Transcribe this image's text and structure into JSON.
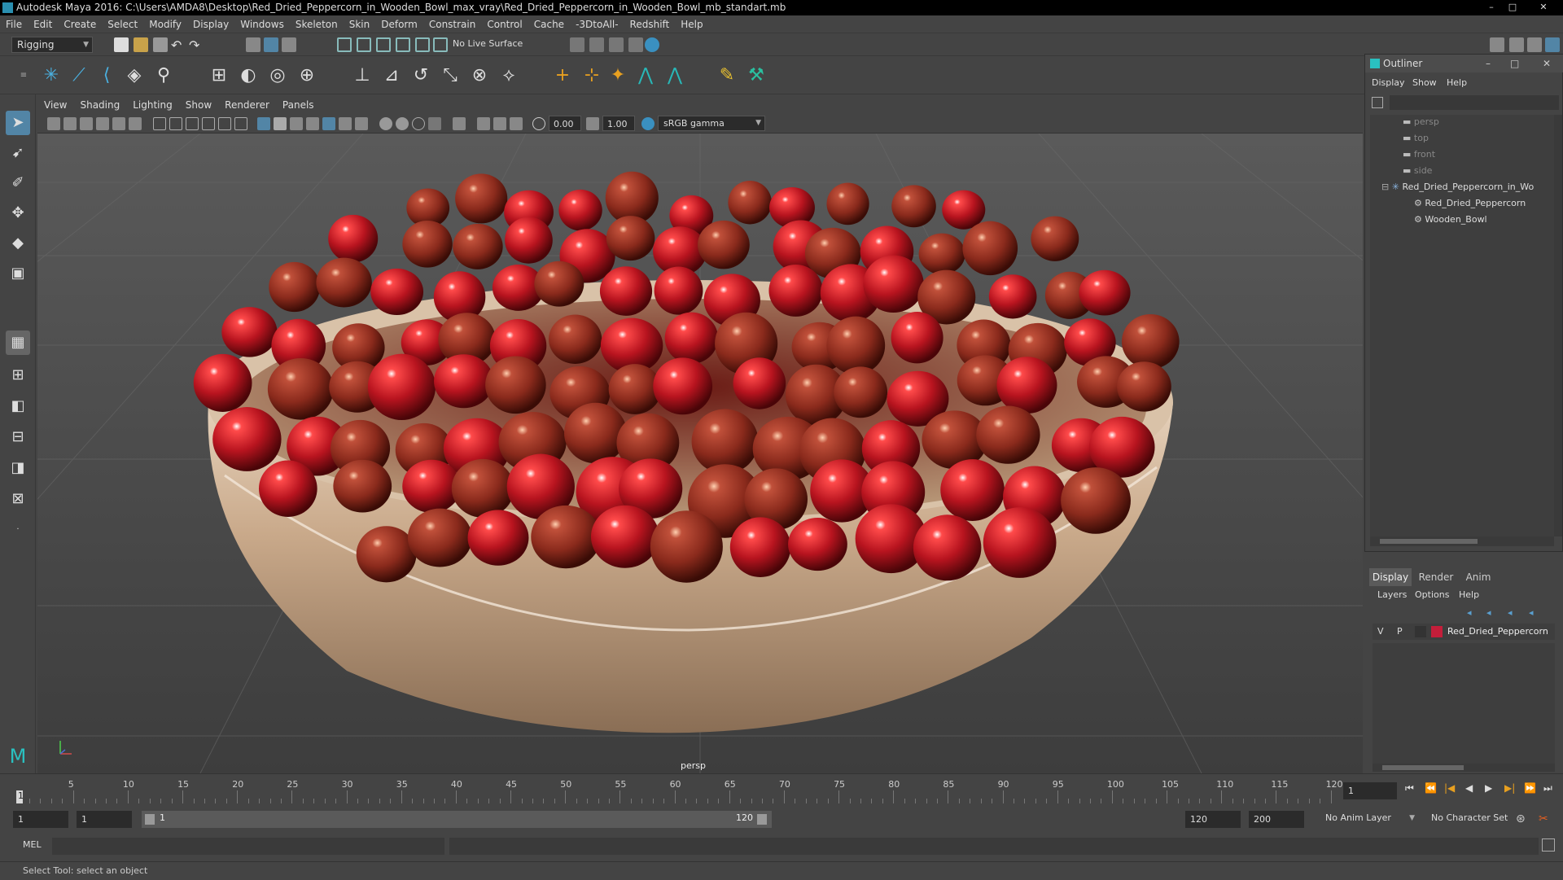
{
  "window": {
    "title": "Autodesk Maya 2016: C:\\Users\\AMDA8\\Desktop\\Red_Dried_Peppercorn_in_Wooden_Bowl_max_vray\\Red_Dried_Peppercorn_in_Wooden_Bowl_mb_standart.mb",
    "controls": [
      "–",
      "□",
      "✕"
    ]
  },
  "menubar": [
    "File",
    "Edit",
    "Create",
    "Select",
    "Modify",
    "Display",
    "Windows",
    "Skeleton",
    "Skin",
    "Deform",
    "Constrain",
    "Control",
    "Cache",
    "-3DtoAll-",
    "Redshift",
    "Help"
  ],
  "statusline": {
    "mode": "Rigging",
    "live_surface": "No Live Surface"
  },
  "viewport": {
    "menu": [
      "View",
      "Shading",
      "Lighting",
      "Show",
      "Renderer",
      "Panels"
    ],
    "exposure": "0.00",
    "gamma": "1.00",
    "color_space": "sRGB gamma",
    "camera_label": "persp"
  },
  "outliner": {
    "title": "Outliner",
    "menu": [
      "Display",
      "Show",
      "Help"
    ],
    "items": [
      {
        "label": "persp",
        "indent": 1,
        "dim": true
      },
      {
        "label": "top",
        "indent": 1,
        "dim": true
      },
      {
        "label": "front",
        "indent": 1,
        "dim": true
      },
      {
        "label": "side",
        "indent": 1,
        "dim": true
      },
      {
        "label": "Red_Dried_Peppercorn_in_Wo",
        "indent": 0,
        "dim": false
      },
      {
        "label": "Red_Dried_Peppercorn",
        "indent": 2,
        "dim": false
      },
      {
        "label": "Wooden_Bowl",
        "indent": 2,
        "dim": false
      }
    ]
  },
  "channel_box": {
    "tabs": [
      "Display",
      "Render",
      "Anim"
    ],
    "menu": [
      "Layers",
      "Options",
      "Help"
    ],
    "layer": {
      "v": "V",
      "p": "P",
      "name": "Red_Dried_Peppercorn",
      "color": "#c41e3a"
    }
  },
  "timeslider": {
    "ticks": [
      "5",
      "10",
      "15",
      "20",
      "25",
      "30",
      "35",
      "40",
      "45",
      "50",
      "55",
      "60",
      "65",
      "70",
      "75",
      "80",
      "85",
      "90",
      "95",
      "100",
      "105",
      "110",
      "115",
      "120"
    ],
    "current_frame_marker": "1",
    "current_frame": "1",
    "playback_controls": [
      "⏮",
      "⏪",
      "|◀",
      "◀",
      "▶",
      "▶|",
      "⏩",
      "⏭"
    ]
  },
  "range": {
    "start": "1",
    "playback_start": "1",
    "range_start_label": "1",
    "range_end_label": "120",
    "playback_end": "120",
    "end": "200",
    "anim_layer": "No Anim Layer",
    "character_set": "No Character Set"
  },
  "mel": {
    "label": "MEL"
  },
  "help_line": "Select Tool: select an object",
  "colors": {
    "accent": "#5285a6",
    "peppercorn": "#b8141f",
    "bowl": "#c9a98a"
  }
}
